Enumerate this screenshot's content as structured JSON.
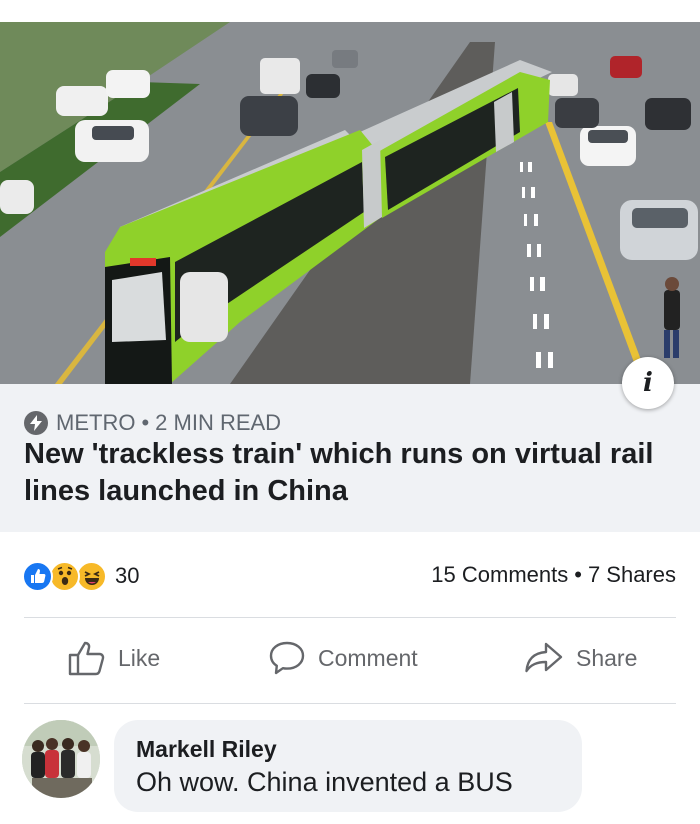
{
  "article": {
    "image_alt": "Green trackless train on a city road",
    "info_icon": "info-icon",
    "source": "METRO",
    "separator": "•",
    "read_time": "2 MIN READ",
    "headline": "New 'trackless train' which runs on virtual rail lines launched in China"
  },
  "engagement": {
    "reaction_icons": [
      "like-icon",
      "wow-icon",
      "haha-icon"
    ],
    "reaction_count": "30",
    "comments": "15 Comments",
    "separator": "•",
    "shares": "7 Shares"
  },
  "actions": {
    "like": "Like",
    "comment": "Comment",
    "share": "Share"
  },
  "comment": {
    "author": "Markell Riley",
    "text": "Oh wow. China invented a BUS"
  },
  "colors": {
    "facebook_blue": "#1877f2",
    "reaction_yellow": "#f7b928",
    "train_green": "#8fd12a",
    "muted_text": "#65676b"
  }
}
